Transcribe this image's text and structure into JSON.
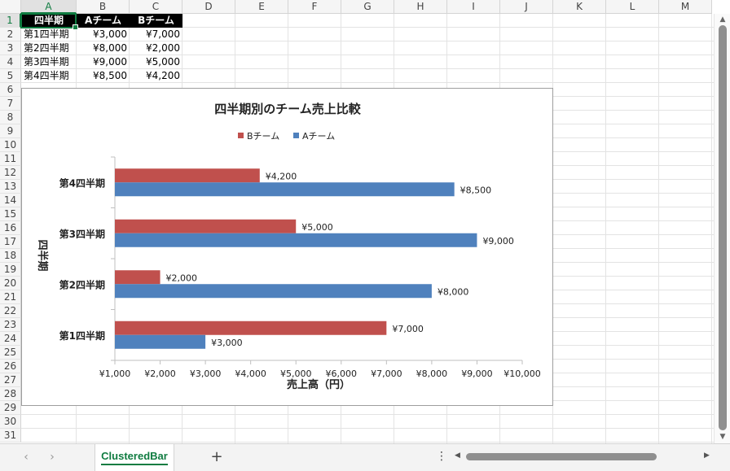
{
  "columns": [
    "A",
    "B",
    "C",
    "D",
    "E",
    "F",
    "G",
    "H",
    "I",
    "J",
    "K",
    "L",
    "M"
  ],
  "rows": [
    "1",
    "2",
    "3",
    "4",
    "5",
    "6",
    "7",
    "8",
    "9",
    "10",
    "11",
    "12",
    "13",
    "14",
    "15",
    "16",
    "17",
    "18",
    "19",
    "20",
    "21",
    "22",
    "23",
    "24",
    "25",
    "26",
    "27",
    "28",
    "29",
    "30",
    "31"
  ],
  "table": {
    "headers": [
      "四半期",
      "Aチーム",
      "Bチーム"
    ],
    "rows": [
      [
        "第1四半期",
        "¥3,000",
        "¥7,000"
      ],
      [
        "第2四半期",
        "¥8,000",
        "¥2,000"
      ],
      [
        "第3四半期",
        "¥9,000",
        "¥5,000"
      ],
      [
        "第4四半期",
        "¥8,500",
        "¥4,200"
      ]
    ]
  },
  "chart_data": {
    "type": "bar",
    "orientation": "horizontal",
    "title": "四半期別のチーム売上比較",
    "xlabel": "売上高（円）",
    "ylabel": "四半期",
    "categories": [
      "第1四半期",
      "第2四半期",
      "第3四半期",
      "第4四半期"
    ],
    "series": [
      {
        "name": "Aチーム",
        "values": [
          3000,
          8000,
          9000,
          8500
        ],
        "color": "#4f81bd",
        "labels": [
          "¥3,000",
          "¥8,000",
          "¥9,000",
          "¥8,500"
        ]
      },
      {
        "name": "Bチーム",
        "values": [
          7000,
          2000,
          5000,
          4200
        ],
        "color": "#c0504d",
        "labels": [
          "¥7,000",
          "¥2,000",
          "¥5,000",
          "¥4,200"
        ]
      }
    ],
    "legend_order": [
      "Bチーム",
      "Aチーム"
    ],
    "legend_position": "top",
    "xlim": [
      1000,
      10000
    ],
    "xticks": [
      "¥1,000",
      "¥2,000",
      "¥3,000",
      "¥4,000",
      "¥5,000",
      "¥6,000",
      "¥7,000",
      "¥8,000",
      "¥9,000",
      "¥10,000"
    ],
    "xtick_values": [
      1000,
      2000,
      3000,
      4000,
      5000,
      6000,
      7000,
      8000,
      9000,
      10000
    ],
    "grid": false
  },
  "tabs": {
    "sheet_name": "ClusteredBar",
    "prev_icon": "chevron-left-icon",
    "next_icon": "chevron-right-icon",
    "add_label": "+",
    "more_label": "⋮"
  }
}
